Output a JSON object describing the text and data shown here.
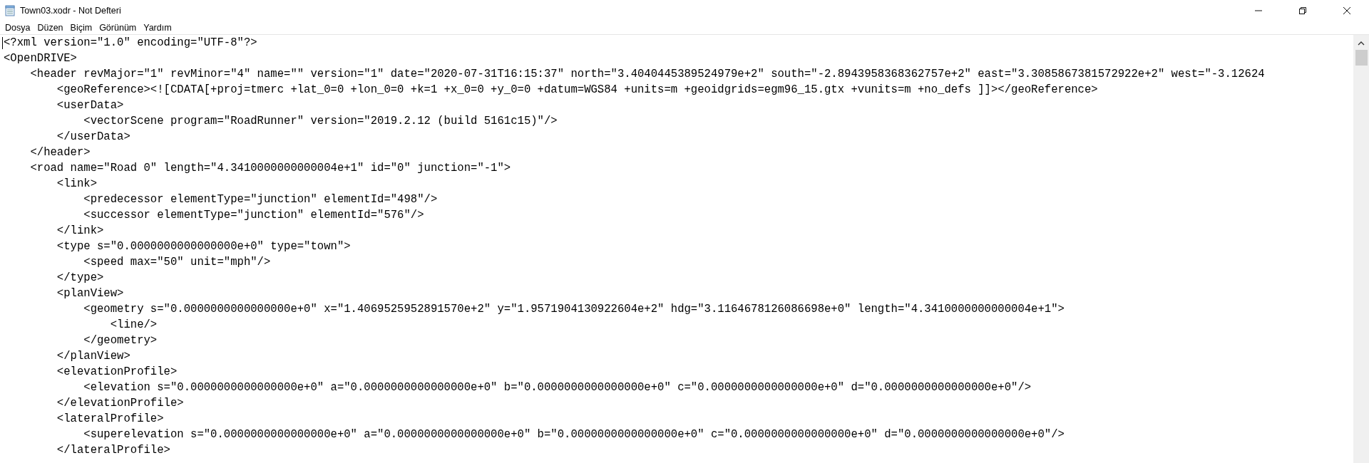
{
  "window": {
    "title": "Town03.xodr - Not Defteri"
  },
  "menu": [
    "Dosya",
    "Düzen",
    "Biçim",
    "Görünüm",
    "Yardım"
  ],
  "editor": {
    "lines": [
      "<?xml version=\"1.0\" encoding=\"UTF-8\"?>",
      "<OpenDRIVE>",
      "    <header revMajor=\"1\" revMinor=\"4\" name=\"\" version=\"1\" date=\"2020-07-31T16:15:37\" north=\"3.4040445389524979e+2\" south=\"-2.8943958368362757e+2\" east=\"3.3085867381572922e+2\" west=\"-3.12624",
      "        <geoReference><![CDATA[+proj=tmerc +lat_0=0 +lon_0=0 +k=1 +x_0=0 +y_0=0 +datum=WGS84 +units=m +geoidgrids=egm96_15.gtx +vunits=m +no_defs ]]></geoReference>",
      "        <userData>",
      "            <vectorScene program=\"RoadRunner\" version=\"2019.2.12 (build 5161c15)\"/>",
      "        </userData>",
      "    </header>",
      "    <road name=\"Road 0\" length=\"4.3410000000000004e+1\" id=\"0\" junction=\"-1\">",
      "        <link>",
      "            <predecessor elementType=\"junction\" elementId=\"498\"/>",
      "            <successor elementType=\"junction\" elementId=\"576\"/>",
      "        </link>",
      "        <type s=\"0.0000000000000000e+0\" type=\"town\">",
      "            <speed max=\"50\" unit=\"mph\"/>",
      "        </type>",
      "        <planView>",
      "            <geometry s=\"0.0000000000000000e+0\" x=\"1.4069525952891570e+2\" y=\"1.9571904130922604e+2\" hdg=\"3.1164678126086698e+0\" length=\"4.3410000000000004e+1\">",
      "                <line/>",
      "            </geometry>",
      "        </planView>",
      "        <elevationProfile>",
      "            <elevation s=\"0.0000000000000000e+0\" a=\"0.0000000000000000e+0\" b=\"0.0000000000000000e+0\" c=\"0.0000000000000000e+0\" d=\"0.0000000000000000e+0\"/>",
      "        </elevationProfile>",
      "        <lateralProfile>",
      "            <superelevation s=\"0.0000000000000000e+0\" a=\"0.0000000000000000e+0\" b=\"0.0000000000000000e+0\" c=\"0.0000000000000000e+0\" d=\"0.0000000000000000e+0\"/>",
      "        </lateralProfile>"
    ]
  }
}
